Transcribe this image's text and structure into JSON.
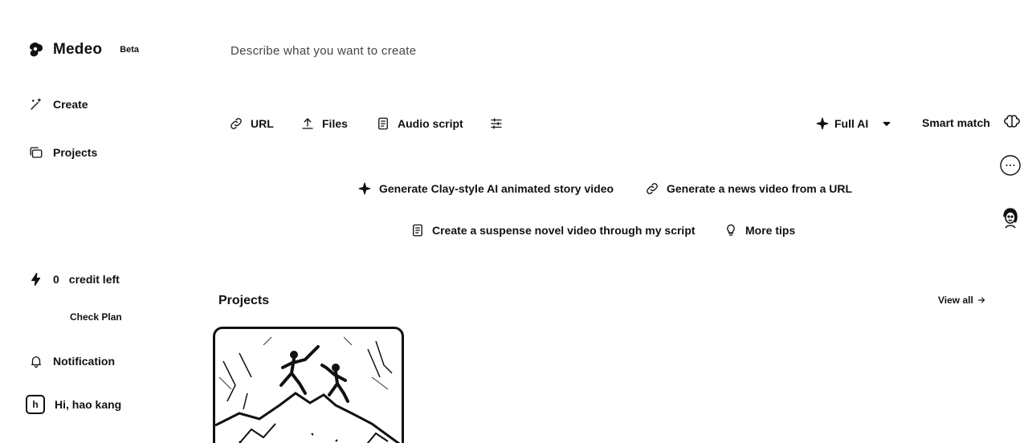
{
  "sidebar": {
    "app_name": "Medeo",
    "badge": "Beta",
    "nav": [
      {
        "label": "Create",
        "icon": "magic-wand-icon"
      },
      {
        "label": "Projects",
        "icon": "folder-stack-icon"
      }
    ],
    "credits": {
      "count": "0",
      "label": "credit left",
      "icon": "lightning-icon"
    },
    "check_plan": "Check Plan",
    "notification": "Notification",
    "user": {
      "greeting": "Hi, hao kang",
      "avatar_text": "h"
    }
  },
  "prompt": {
    "placeholder": "Describe what you want to create"
  },
  "toolbar": {
    "url": "URL",
    "files": "Files",
    "audio_script": "Audio script",
    "mode": "Full AI",
    "match": "Smart match"
  },
  "suggestions": [
    "Generate Clay-style AI animated story video",
    "Generate a news video from a URL",
    "Create a suspense novel video through my script",
    "More tips"
  ],
  "projects": {
    "title": "Projects",
    "view_all": "View all"
  }
}
